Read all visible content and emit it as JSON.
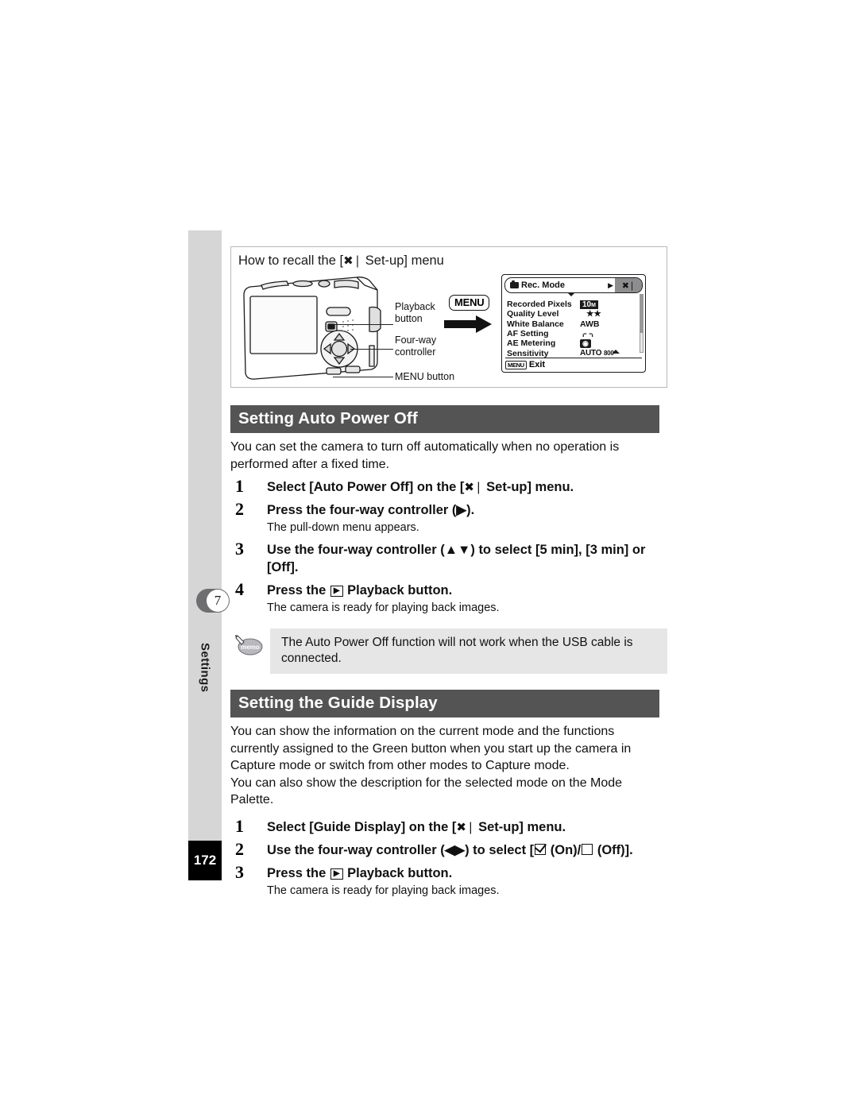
{
  "page": {
    "number": "172",
    "chapter_badge": "7",
    "chapter_name": "Settings"
  },
  "recall_box": {
    "title_before": "How to recall the [",
    "title_icon": "setup-wrench-icon",
    "title_after": " Set-up] menu",
    "callouts": [
      {
        "name": "playback-button",
        "label": "Playback\nbutton"
      },
      {
        "name": "four-way-controller",
        "label": "Four-way\ncontroller"
      },
      {
        "name": "menu-button",
        "label": "MENU button"
      }
    ],
    "menu_chip": "MENU",
    "lcd": {
      "tab_active": "Rec. Mode",
      "tab_next_icon": "setup-wrench-icon",
      "rows": [
        {
          "label": "Recorded Pixels",
          "value": "10",
          "value_sub": "M",
          "style": "badge"
        },
        {
          "label": "Quality Level",
          "value": "★★",
          "style": "plain"
        },
        {
          "label": "White Balance",
          "value": "AWB",
          "style": "plain"
        },
        {
          "label": "AF Setting",
          "value": "⌌  ⌍",
          "style": "brackets"
        },
        {
          "label": "AE Metering",
          "value": "◉",
          "style": "ae"
        },
        {
          "label": "Sensitivity",
          "value": "AUTO ",
          "value_sub": "800",
          "style": "sens"
        }
      ],
      "footer_button": "MENU",
      "footer_label": "Exit"
    }
  },
  "sections": [
    {
      "heading": "Setting Auto Power Off",
      "intro": "You can set the camera to turn off automatically when no operation is performed after a fixed time.",
      "steps": [
        {
          "num": "1",
          "text_parts": [
            {
              "t": "text",
              "v": "Select [Auto Power Off] on the ["
            },
            {
              "t": "icon",
              "v": "setup-wrench-icon"
            },
            {
              "t": "text",
              "v": " Set-up] menu."
            }
          ],
          "note": ""
        },
        {
          "num": "2",
          "text_parts": [
            {
              "t": "text",
              "v": "Press the four-way controller (▶)."
            }
          ],
          "note": "The pull-down menu appears."
        },
        {
          "num": "3",
          "text_parts": [
            {
              "t": "text",
              "v": "Use the four-way controller (▲▼) to select [5 min], [3 min] or [Off]."
            }
          ],
          "note": ""
        },
        {
          "num": "4",
          "text_parts": [
            {
              "t": "text",
              "v": "Press the "
            },
            {
              "t": "icon",
              "v": "playback-icon"
            },
            {
              "t": "text",
              "v": " Playback button."
            }
          ],
          "note": "The camera is ready for playing back images."
        }
      ],
      "memo": "The Auto Power Off function will not work when the USB cable is connected."
    },
    {
      "heading": "Setting the Guide Display",
      "intro": "You can show the information on the current mode and the functions currently assigned to the Green button when you start up the camera in Capture mode or switch from other modes to Capture mode.\nYou can also show the description for the selected mode on the Mode Palette.",
      "steps": [
        {
          "num": "1",
          "text_parts": [
            {
              "t": "text",
              "v": "Select [Guide Display] on the ["
            },
            {
              "t": "icon",
              "v": "setup-wrench-icon"
            },
            {
              "t": "text",
              "v": " Set-up] menu."
            }
          ],
          "note": ""
        },
        {
          "num": "2",
          "text_parts": [
            {
              "t": "text",
              "v": "Use the four-way controller (◀▶) to select ["
            },
            {
              "t": "icon",
              "v": "checkbox-checked-icon"
            },
            {
              "t": "text",
              "v": " (On)/"
            },
            {
              "t": "icon",
              "v": "checkbox-empty-icon"
            },
            {
              "t": "text",
              "v": " (Off)]."
            }
          ],
          "note": ""
        },
        {
          "num": "3",
          "text_parts": [
            {
              "t": "text",
              "v": "Press the "
            },
            {
              "t": "icon",
              "v": "playback-icon"
            },
            {
              "t": "text",
              "v": " Playback button."
            }
          ],
          "note": "The camera is ready for playing back images."
        }
      ],
      "memo": ""
    }
  ],
  "memo_icon_label": "memo",
  "colors": {
    "heading_bar": "#545454",
    "sidebar": "#d6d6d6",
    "memo_box": "#e6e6e6",
    "page_block": "#000000"
  }
}
